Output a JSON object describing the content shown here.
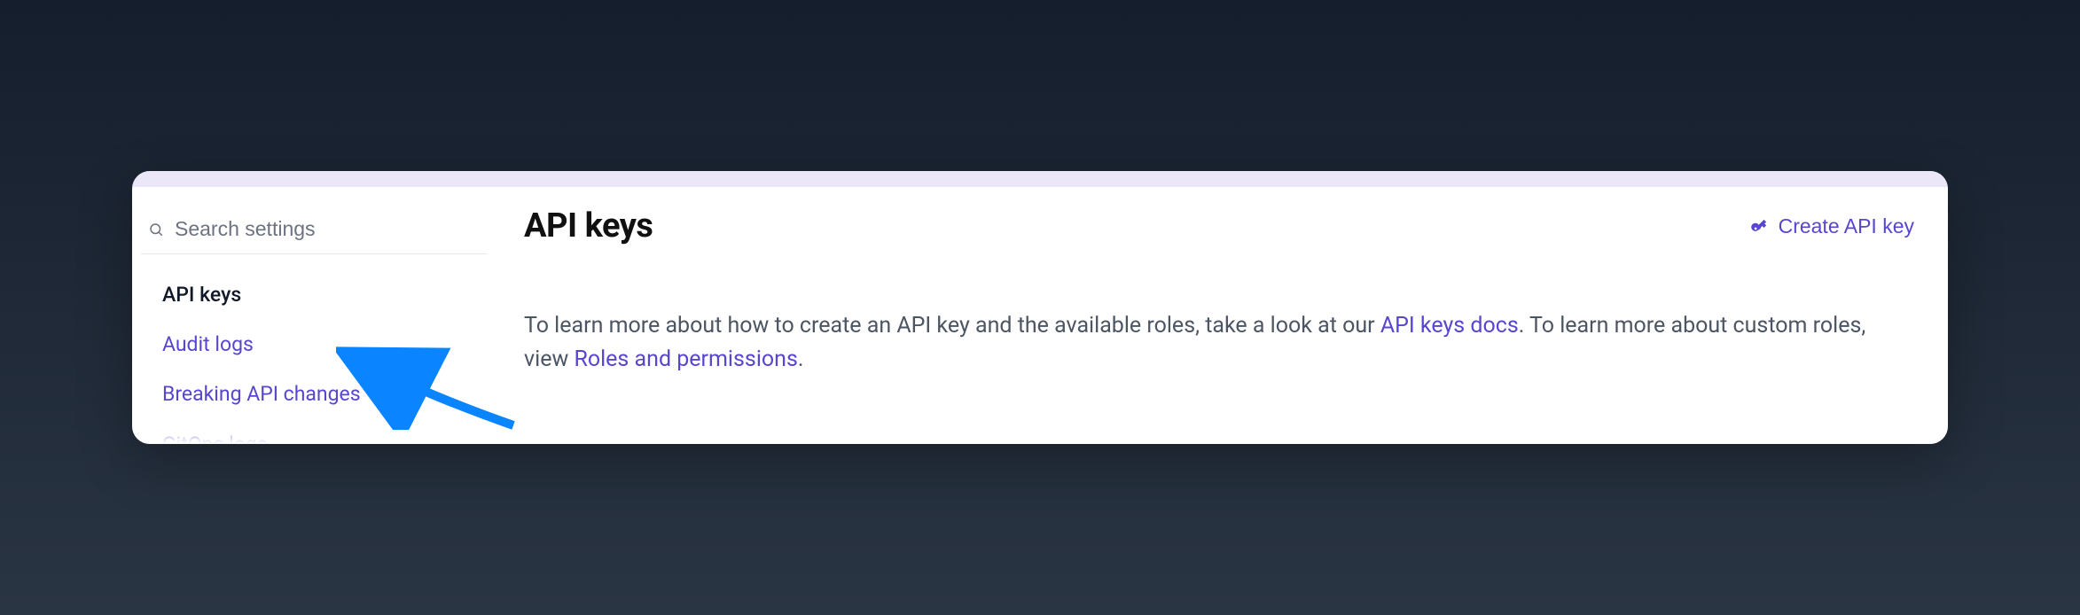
{
  "sidebar": {
    "search_placeholder": "Search settings",
    "items": [
      {
        "label": "API keys",
        "active": true
      },
      {
        "label": "Audit logs",
        "active": false
      },
      {
        "label": "Breaking API changes",
        "active": false
      },
      {
        "label": "GitOps logs",
        "active": false
      }
    ]
  },
  "main": {
    "title": "API keys",
    "create_button": "Create API key",
    "description": {
      "part1": "To learn more about how to create an API key and the available roles, take a look at our ",
      "link1": "API keys docs",
      "part2": ". To learn more about custom roles, view ",
      "link2": "Roles and permissions",
      "part3": "."
    }
  },
  "colors": {
    "accent": "#5746cf",
    "annotation": "#0a84ff"
  }
}
